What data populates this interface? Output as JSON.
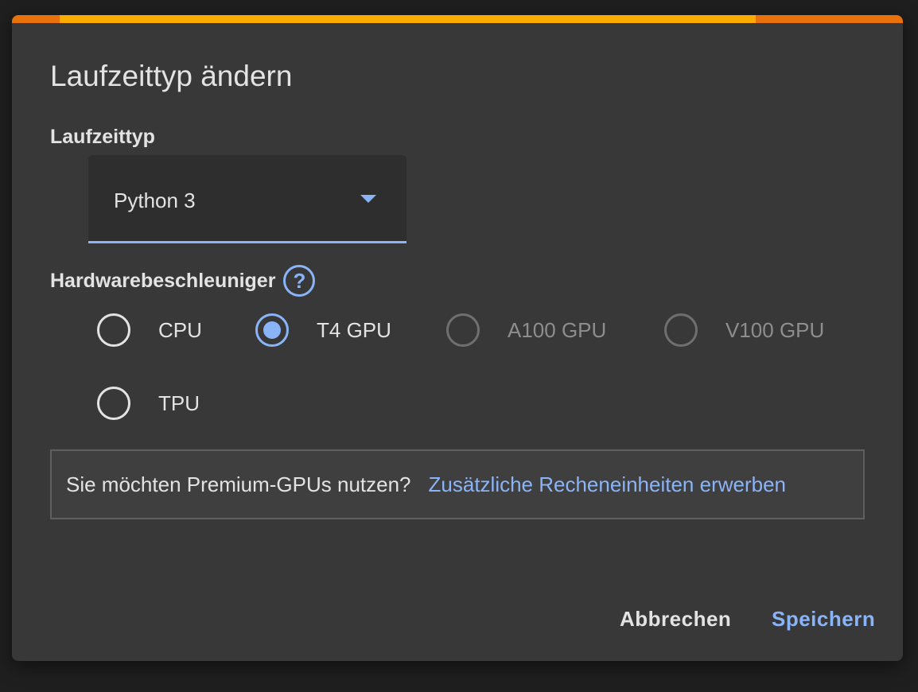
{
  "dialog": {
    "title": "Laufzeittyp ändern",
    "accent_colors": [
      "#e8710a",
      "#f9ab00"
    ]
  },
  "runtime": {
    "label": "Laufzeittyp",
    "selected": "Python 3"
  },
  "hardware": {
    "label": "Hardwarebeschleuniger",
    "help_icon": "?",
    "options": [
      {
        "label": "CPU",
        "checked": false,
        "disabled": false
      },
      {
        "label": "T4 GPU",
        "checked": true,
        "disabled": false
      },
      {
        "label": "A100 GPU",
        "checked": false,
        "disabled": true
      },
      {
        "label": "V100 GPU",
        "checked": false,
        "disabled": true
      },
      {
        "label": "TPU",
        "checked": false,
        "disabled": false
      }
    ]
  },
  "premium": {
    "text": "Sie möchten Premium-GPUs nutzen?",
    "link": "Zusätzliche Recheneinheiten erwerben"
  },
  "buttons": {
    "cancel": "Abbrechen",
    "save": "Speichern"
  },
  "colors": {
    "accent": "#8ab4f8",
    "background": "#383838",
    "text": "#e3e3e3",
    "disabled": "#8e8e8e"
  }
}
